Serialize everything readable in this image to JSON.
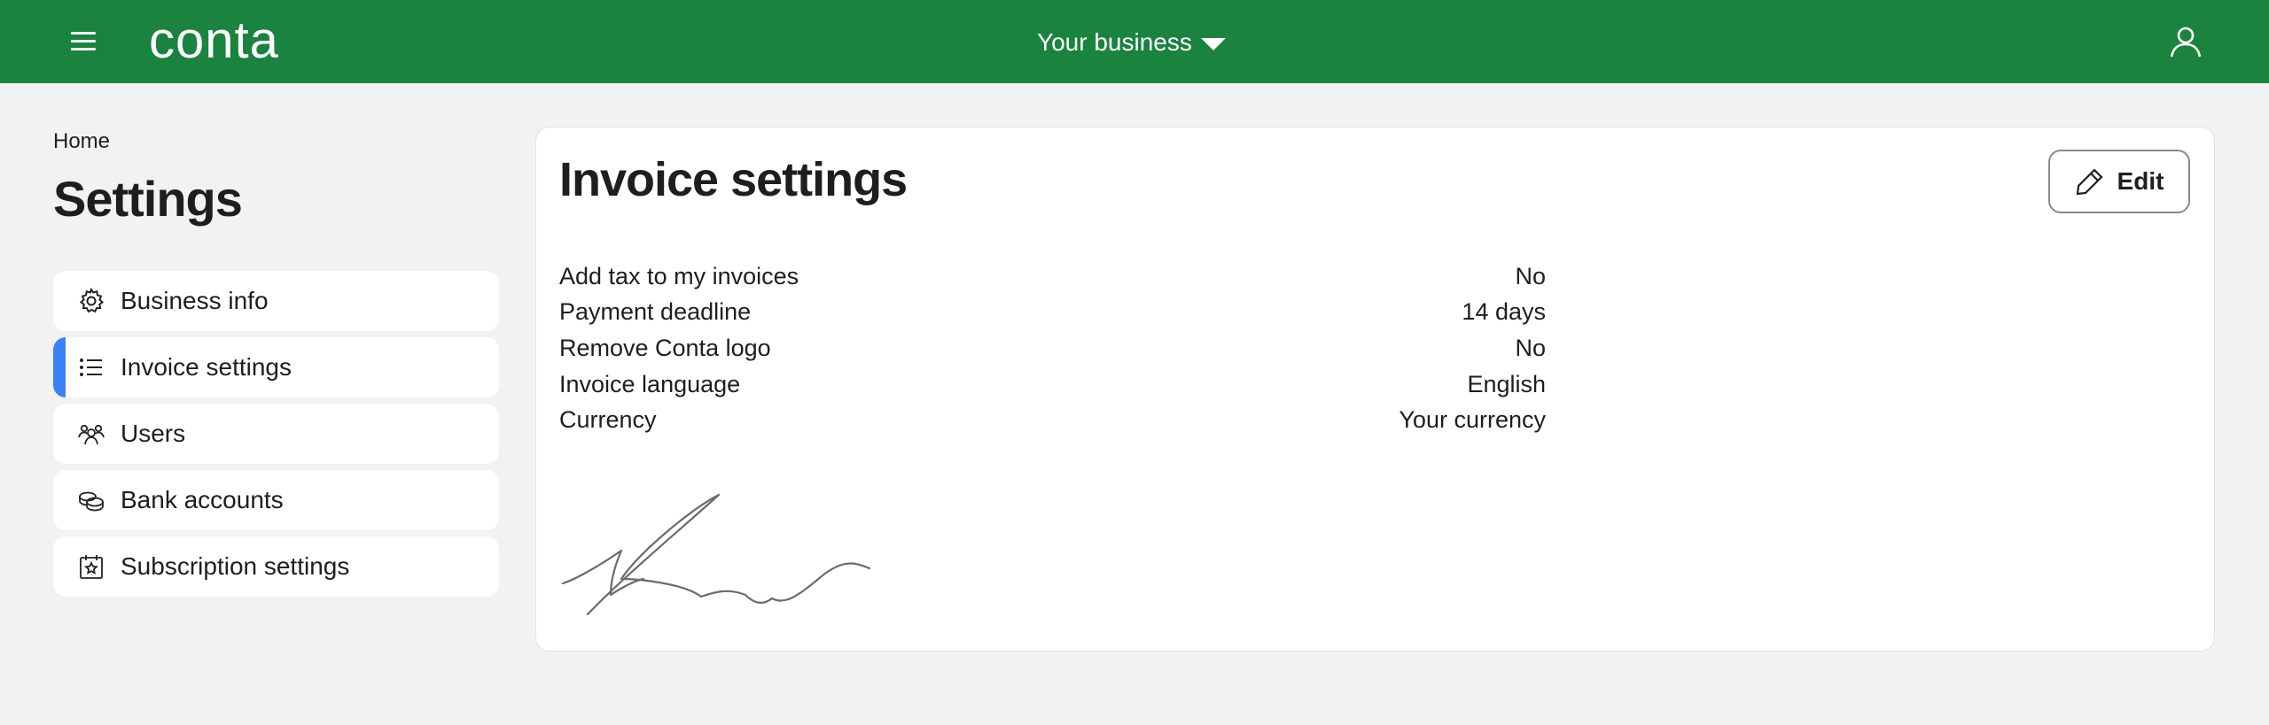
{
  "header": {
    "logo_text": "conta",
    "business_label": "Your business",
    "brand_color": "#1a833f",
    "icons": {
      "menu": "hamburger-menu-icon",
      "caret": "caret-down-icon",
      "user": "user-icon"
    }
  },
  "breadcrumb": "Home",
  "page_title": "Settings",
  "sidebar": {
    "accent_color": "#3b82f6",
    "items": [
      {
        "label": "Business info",
        "icon": "gear-icon",
        "active": false
      },
      {
        "label": "Invoice settings",
        "icon": "list-icon",
        "active": true
      },
      {
        "label": "Users",
        "icon": "users-icon",
        "active": false
      },
      {
        "label": "Bank accounts",
        "icon": "coins-icon",
        "active": false
      },
      {
        "label": "Subscription settings",
        "icon": "calendar-star-icon",
        "active": false
      }
    ]
  },
  "card": {
    "title": "Invoice settings",
    "edit_label": "Edit",
    "edit_icon": "pencil-icon",
    "rows": [
      {
        "label": "Add tax to my invoices",
        "value": "No"
      },
      {
        "label": "Payment deadline",
        "value": "14 days"
      },
      {
        "label": "Remove Conta logo",
        "value": "No"
      },
      {
        "label": "Invoice language",
        "value": "English"
      },
      {
        "label": "Currency",
        "value": "Your currency"
      }
    ],
    "signature_icon": "signature-image"
  }
}
